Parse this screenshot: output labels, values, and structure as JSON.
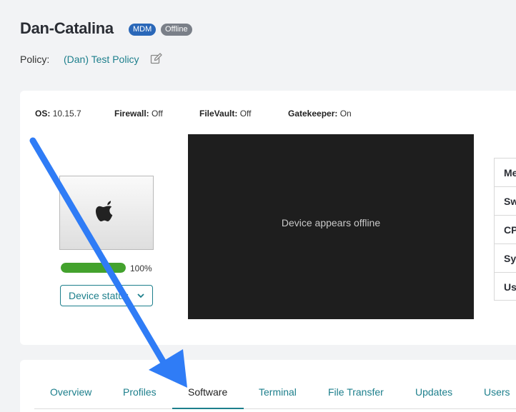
{
  "device": {
    "name": "Dan-Catalina",
    "badges": {
      "mdm": "MDM",
      "status": "Offline"
    }
  },
  "policy": {
    "label": "Policy:",
    "value": "(Dan) Test Policy"
  },
  "stats": {
    "os": {
      "label": "OS:",
      "value": "10.15.7"
    },
    "firewall": {
      "label": "Firewall:",
      "value": "Off"
    },
    "filevault": {
      "label": "FileVault:",
      "value": "Off"
    },
    "gatekeeper": {
      "label": "Gatekeeper:",
      "value": "On"
    }
  },
  "progress": {
    "percent": 100,
    "label": "100%"
  },
  "device_status_button": "Device status",
  "remote_screen": {
    "message": "Device appears offline"
  },
  "side_list": [
    "Me",
    "Sw",
    "CP",
    "Sy",
    "Us"
  ],
  "tabs": [
    {
      "label": "Overview"
    },
    {
      "label": "Profiles"
    },
    {
      "label": "Software",
      "active": true
    },
    {
      "label": "Terminal"
    },
    {
      "label": "File Transfer"
    },
    {
      "label": "Updates"
    },
    {
      "label": "Users"
    }
  ],
  "icons": {
    "edit": "edit-icon",
    "device_logo": "apple-logo-icon",
    "dropdown": "chevron-down-icon",
    "annotation": "annotation-arrow"
  },
  "colors": {
    "accent": "#1d7f8c",
    "mdm_badge": "#2a67b8",
    "offline_badge": "#7a7f88",
    "progress": "#43a22d",
    "annotation_arrow": "#2f7cf6"
  }
}
